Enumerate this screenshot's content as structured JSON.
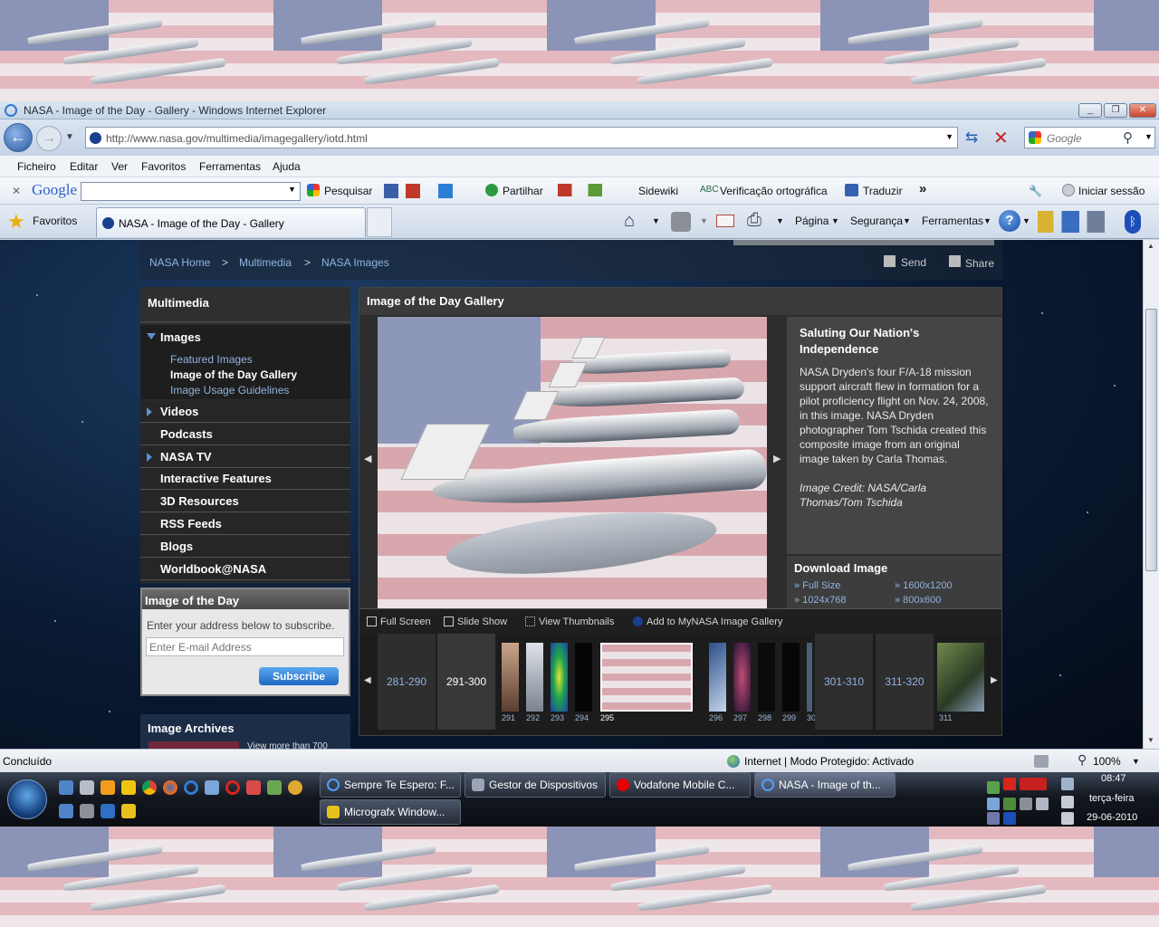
{
  "window": {
    "title": "NASA - Image of the Day - Gallery - Windows Internet Explorer",
    "url": "http://www.nasa.gov/multimedia/imagegallery/iotd.html",
    "search_placeholder": "Google"
  },
  "menu": [
    "Ficheiro",
    "Editar",
    "Ver",
    "Favoritos",
    "Ferramentas",
    "Ajuda"
  ],
  "google_toolbar": {
    "logo": "Google",
    "items": [
      "Pesquisar",
      "Partilhar",
      "Sidewiki",
      "Verificação ortográfica",
      "Traduzir",
      "Iniciar sessão"
    ],
    "more": "»"
  },
  "favorites_bar": {
    "favorites": "Favoritos",
    "tab_title": "NASA - Image of the Day - Gallery",
    "commands": [
      "Página",
      "Segurança",
      "Ferramentas"
    ]
  },
  "page": {
    "breadcrumb": [
      "NASA Home",
      "Multimedia",
      "NASA Images"
    ],
    "breadcrumb_sep": ">",
    "actions": {
      "send": "Send",
      "share": "Share"
    },
    "leftnav": {
      "title": "Multimedia",
      "images": "Images",
      "image_sub": [
        "Featured Images",
        "Image of the Day Gallery",
        "Image Usage Guidelines"
      ],
      "items": [
        "Videos",
        "Podcasts",
        "NASA TV",
        "Interactive Features",
        "3D Resources",
        "RSS Feeds",
        "Blogs",
        "Worldbook@NASA"
      ]
    },
    "iotd_subscribe": {
      "title": "Image of the Day",
      "text": "Enter your address below to subscribe.",
      "email_placeholder": "Enter E-mail Address",
      "button": "Subscribe"
    },
    "archives": {
      "title": "Image Archives",
      "text": "View more than 700"
    },
    "gallery": {
      "title": "Image of the Day Gallery",
      "image_title": "Saluting Our Nation's Independence",
      "description": "NASA Dryden's four F/A-18 mission support aircraft flew in formation for a pilot proficiency flight on Nov. 24, 2008, in this image. NASA Dryden photographer Tom Tschida created this composite image from an original image taken by Carla Thomas.",
      "credit": "Image Credit: NASA/Carla Thomas/Tom Tschida",
      "download_title": "Download Image",
      "downloads": [
        "» Full Size",
        "» 1600x1200",
        "» 1024x768",
        "» 800x600"
      ],
      "tools": [
        "Full Screen",
        "Slide Show",
        "View Thumbnails",
        "Add to MyNASA Image Gallery"
      ],
      "ranges": [
        "281-290",
        "291-300",
        "301-310",
        "311-320"
      ],
      "thumbs": [
        "291",
        "292",
        "293",
        "294",
        "295",
        "296",
        "297",
        "298",
        "299",
        "30",
        "311"
      ]
    }
  },
  "status": {
    "left": "Concluído",
    "zone": "Internet | Modo Protegido: Activado",
    "zoom": "100%"
  },
  "taskbar": {
    "buttons": [
      "Sempre Te Espero: F...",
      "Gestor de Dispositivos",
      "Vodafone Mobile C...",
      "NASA - Image of th...",
      "Micrografx Window..."
    ],
    "time": "08:47",
    "day": "terça-feira",
    "date": "29-06-2010"
  },
  "colors": {
    "nasa_link": "#8fb3e0",
    "subscribe_button": "#2d7fd6",
    "ie_titlebar": "#c6d4e6"
  }
}
